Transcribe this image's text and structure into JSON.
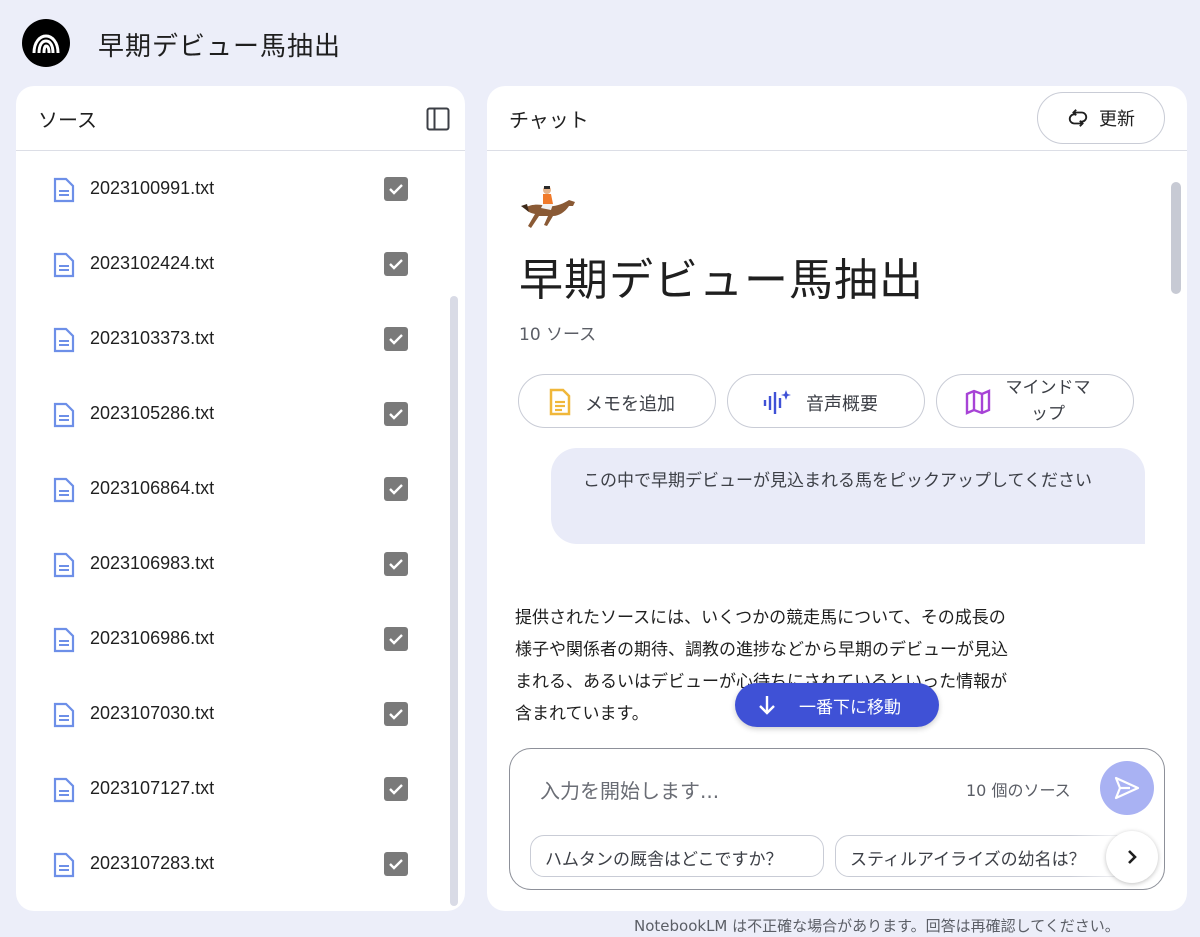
{
  "app": {
    "title": "早期デビュー馬抽出"
  },
  "sources": {
    "header": "ソース",
    "items": [
      {
        "name": "2023100991.txt",
        "checked": true
      },
      {
        "name": "2023102424.txt",
        "checked": true
      },
      {
        "name": "2023103373.txt",
        "checked": true
      },
      {
        "name": "2023105286.txt",
        "checked": true
      },
      {
        "name": "2023106864.txt",
        "checked": true
      },
      {
        "name": "2023106983.txt",
        "checked": true
      },
      {
        "name": "2023106986.txt",
        "checked": true
      },
      {
        "name": "2023107030.txt",
        "checked": true
      },
      {
        "name": "2023107127.txt",
        "checked": true
      },
      {
        "name": "2023107283.txt",
        "checked": true
      }
    ]
  },
  "chat": {
    "header": "チャット",
    "refresh_label": "更新",
    "emoji": "🏇",
    "notebook_title": "早期デビュー馬抽出",
    "source_count": "10 ソース",
    "actions": {
      "memo": "メモを追加",
      "audio": "音声概要",
      "mindmap_line1": "マインドマ",
      "mindmap_line2": "ップ"
    },
    "user_message": "この中で早期デビューが見込まれる馬をピックアップしてください",
    "answer_lines": [
      "提供されたソースには、いくつかの競走馬について、その成長の",
      "様子や関係者の期待、調教の進捗などから早期のデビューが見込",
      "まれる、あるいはデビューが心待ちにされているといった情報が",
      "含まれています。"
    ],
    "scroll_down_label": "一番下に移動",
    "input": {
      "placeholder": "入力を開始します...",
      "source_count": "10 個のソース"
    },
    "suggestions": [
      "ハムタンの厩舎はどこですか？",
      "スティルアイライズの幼名は？"
    ]
  },
  "footer": {
    "note": "NotebookLM は不正確な場合があります。回答は再確認してください。"
  },
  "colors": {
    "accent": "#3f51d6",
    "send_disabled": "#a9b2f3",
    "file_icon": "#6d8fe8"
  }
}
